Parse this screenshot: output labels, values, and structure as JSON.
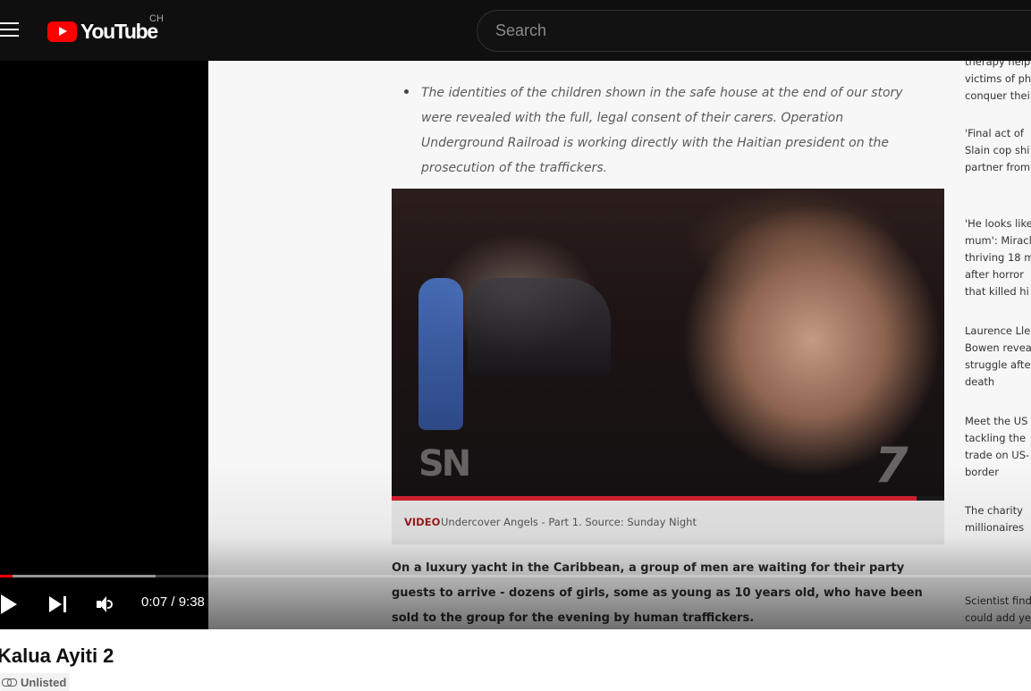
{
  "header": {
    "logo_text": "YouTube",
    "country_code": "CH",
    "search_placeholder": "Search"
  },
  "frame": {
    "bullet_text": "The identities of the children shown in the safe house at the end of our story were revealed with the full, legal consent of their carers. Operation Underground Railroad is working directly with the Haitian president on the prosecution of the traffickers.",
    "watermark_left": "SN",
    "watermark_right": "7",
    "inner_progress_fraction": 0.95,
    "caption_tag": "VIDEO",
    "caption_text": "Undercover Angels - Part 1. Source: Sunday Night",
    "article_body": "On a luxury yacht in the Caribbean, a group of men are waiting for their party guests to arrive - dozens of girls, some as young as 10 years old, who have been sold to the group for the evening by human traffickers.",
    "sidebar_items": [
      [
        "therapy help",
        "victims of ph",
        "conquer thei"
      ],
      [
        "'Final act of",
        "Slain cop shi",
        "partner from"
      ],
      [
        "'He looks like",
        "mum': Miracl",
        "thriving 18 m",
        "after horror",
        "that killed hi"
      ],
      [
        "Laurence Lle",
        "Bowen revea",
        "struggle afte",
        "death"
      ],
      [
        "Meet the US",
        "tackling the",
        "trade on US-",
        "border"
      ],
      [
        "The charity",
        "millionaires"
      ],
      [
        "Scientist find",
        "could add ye"
      ]
    ]
  },
  "player": {
    "current_time": "0:07",
    "duration": "9:38",
    "time_display": "0:07 / 9:38",
    "played_fraction": 0.012,
    "loaded_fraction": 0.151
  },
  "video": {
    "title": "Kalua Ayiti 2",
    "visibility": "Unlisted"
  },
  "colors": {
    "masthead_bg": "#0f0f0f",
    "brand_red": "#ff0000",
    "progress_red": "#ff0000"
  },
  "icons": [
    "menu-icon",
    "youtube-logo-icon",
    "play-icon",
    "next-icon",
    "volume-icon",
    "link-icon"
  ]
}
